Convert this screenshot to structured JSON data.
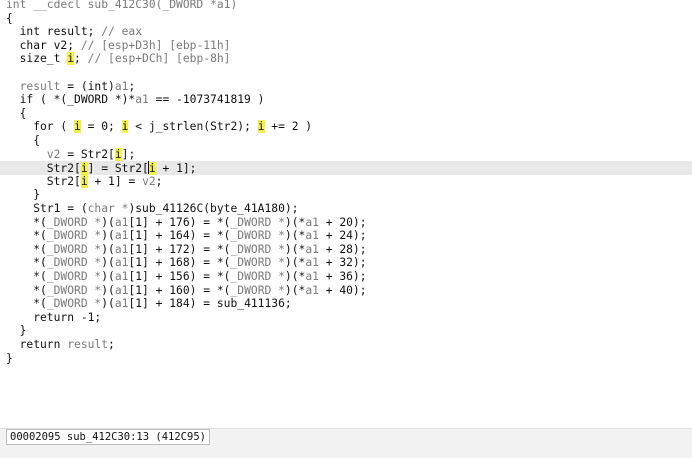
{
  "code": {
    "lines": [
      [
        {
          "t": "int __cdecl sub_412C30(_DWORD *a1)",
          "c": "cm"
        }
      ],
      [
        {
          "t": "{"
        }
      ],
      [
        {
          "t": "  int result; "
        },
        {
          "t": "// eax",
          "c": "cm"
        }
      ],
      [
        {
          "t": "  char v2; "
        },
        {
          "t": "// [esp+D3h] [ebp-11h]",
          "c": "cm"
        }
      ],
      [
        {
          "t": "  size_t "
        },
        {
          "t": "i",
          "c": "mark"
        },
        {
          "t": "; "
        },
        {
          "t": "// [esp+DCh] [ebp-8h]",
          "c": "cm"
        }
      ],
      [
        {
          "t": ""
        }
      ],
      [
        {
          "t": "  "
        },
        {
          "t": "result",
          "c": "var"
        },
        {
          "t": " = (int)"
        },
        {
          "t": "a1",
          "c": "var"
        },
        {
          "t": ";"
        }
      ],
      [
        {
          "t": "  if ( *(_DWORD *)*"
        },
        {
          "t": "a1",
          "c": "var"
        },
        {
          "t": " == -1073741819 )"
        }
      ],
      [
        {
          "t": "  {"
        }
      ],
      [
        {
          "t": "    for ( "
        },
        {
          "t": "i",
          "c": "mark"
        },
        {
          "t": " = 0; "
        },
        {
          "t": "i",
          "c": "mark"
        },
        {
          "t": " < j_strlen(Str2); "
        },
        {
          "t": "i",
          "c": "mark"
        },
        {
          "t": " += 2 )"
        }
      ],
      [
        {
          "t": "    {"
        }
      ],
      [
        {
          "t": "      "
        },
        {
          "t": "v2",
          "c": "var"
        },
        {
          "t": " = Str2["
        },
        {
          "t": "i",
          "c": "mark"
        },
        {
          "t": "];"
        }
      ],
      [
        {
          "t": "      Str2["
        },
        {
          "t": "i",
          "c": "mark"
        },
        {
          "t": "] = Str2["
        },
        {
          "t": "CARET"
        },
        {
          "t": "i",
          "c": "mark"
        },
        {
          "t": " + 1];"
        }
      ],
      [
        {
          "t": "      Str2["
        },
        {
          "t": "i",
          "c": "mark"
        },
        {
          "t": " + 1] = "
        },
        {
          "t": "v2",
          "c": "var"
        },
        {
          "t": ";"
        }
      ],
      [
        {
          "t": "    }"
        }
      ],
      [
        {
          "t": "    Str1 = ("
        },
        {
          "t": "char *",
          "c": "cm"
        },
        {
          "t": ")sub_41126C(byte_41A180);"
        }
      ],
      [
        {
          "t": "    *("
        },
        {
          "t": "_DWORD *",
          "c": "cm"
        },
        {
          "t": ")("
        },
        {
          "t": "a1",
          "c": "var"
        },
        {
          "t": "[1] + 176) = *("
        },
        {
          "t": "_DWORD *",
          "c": "cm"
        },
        {
          "t": ")(*"
        },
        {
          "t": "a1",
          "c": "var"
        },
        {
          "t": " + 20);"
        }
      ],
      [
        {
          "t": "    *("
        },
        {
          "t": "_DWORD *",
          "c": "cm"
        },
        {
          "t": ")("
        },
        {
          "t": "a1",
          "c": "var"
        },
        {
          "t": "[1] + 164) = *("
        },
        {
          "t": "_DWORD *",
          "c": "cm"
        },
        {
          "t": ")(*"
        },
        {
          "t": "a1",
          "c": "var"
        },
        {
          "t": " + 24);"
        }
      ],
      [
        {
          "t": "    *("
        },
        {
          "t": "_DWORD *",
          "c": "cm"
        },
        {
          "t": ")("
        },
        {
          "t": "a1",
          "c": "var"
        },
        {
          "t": "[1] + 172) = *("
        },
        {
          "t": "_DWORD *",
          "c": "cm"
        },
        {
          "t": ")(*"
        },
        {
          "t": "a1",
          "c": "var"
        },
        {
          "t": " + 28);"
        }
      ],
      [
        {
          "t": "    *("
        },
        {
          "t": "_DWORD *",
          "c": "cm"
        },
        {
          "t": ")("
        },
        {
          "t": "a1",
          "c": "var"
        },
        {
          "t": "[1] + 168) = *("
        },
        {
          "t": "_DWORD *",
          "c": "cm"
        },
        {
          "t": ")(*"
        },
        {
          "t": "a1",
          "c": "var"
        },
        {
          "t": " + 32);"
        }
      ],
      [
        {
          "t": "    *("
        },
        {
          "t": "_DWORD *",
          "c": "cm"
        },
        {
          "t": ")("
        },
        {
          "t": "a1",
          "c": "var"
        },
        {
          "t": "[1] + 156) = *("
        },
        {
          "t": "_DWORD *",
          "c": "cm"
        },
        {
          "t": ")(*"
        },
        {
          "t": "a1",
          "c": "var"
        },
        {
          "t": " + 36);"
        }
      ],
      [
        {
          "t": "    *("
        },
        {
          "t": "_DWORD *",
          "c": "cm"
        },
        {
          "t": ")("
        },
        {
          "t": "a1",
          "c": "var"
        },
        {
          "t": "[1] + 160) = *("
        },
        {
          "t": "_DWORD *",
          "c": "cm"
        },
        {
          "t": ")(*"
        },
        {
          "t": "a1",
          "c": "var"
        },
        {
          "t": " + 40);"
        }
      ],
      [
        {
          "t": "    *("
        },
        {
          "t": "_DWORD *",
          "c": "cm"
        },
        {
          "t": ")("
        },
        {
          "t": "a1",
          "c": "var"
        },
        {
          "t": "[1] + 184) = sub_411136;"
        }
      ],
      [
        {
          "t": "    return -1;"
        }
      ],
      [
        {
          "t": "  }"
        }
      ],
      [
        {
          "t": "  return "
        },
        {
          "t": "result",
          "c": "var"
        },
        {
          "t": ";"
        }
      ],
      [
        {
          "t": "}"
        }
      ]
    ],
    "highlight_line": 12
  },
  "statusbar": {
    "text": "00002095 sub_412C30:13 (412C95)"
  }
}
